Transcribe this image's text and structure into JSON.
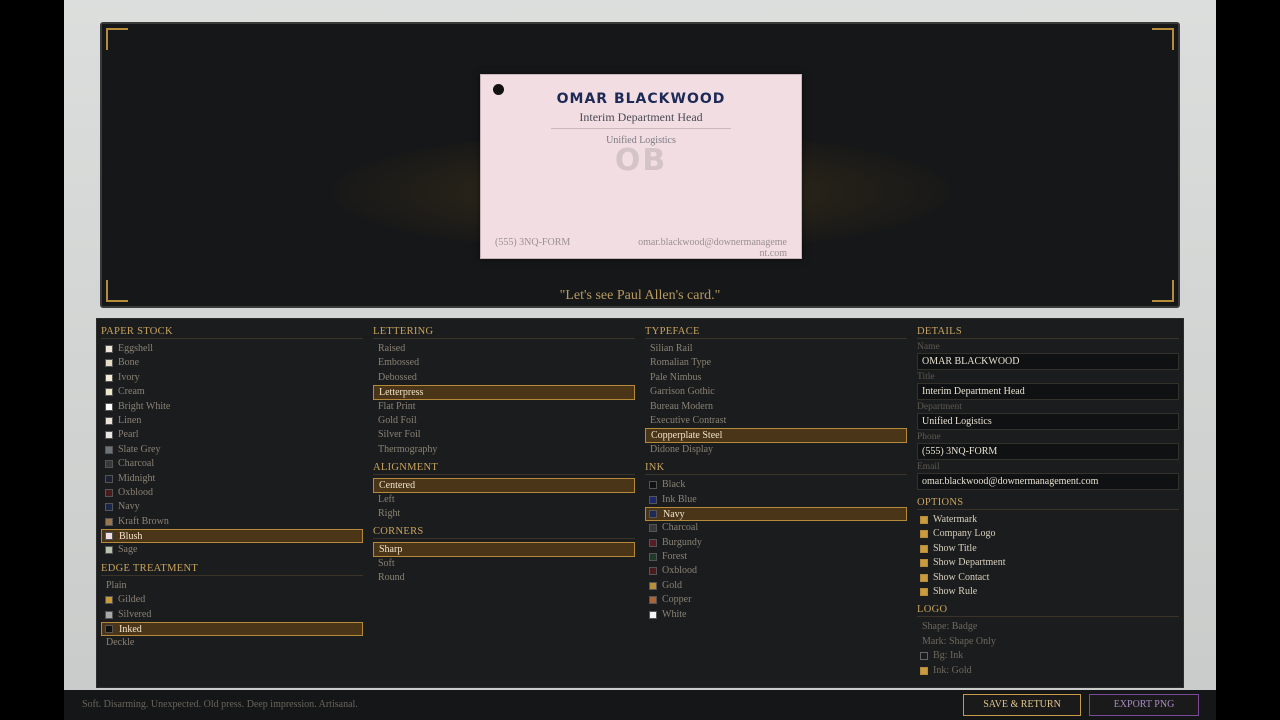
{
  "card": {
    "name": "OMAR BLACKWOOD",
    "title": "Interim Department Head",
    "department": "Unified Logistics",
    "monogram": "OB",
    "phone": "(555) 3NQ-FORM",
    "email": "omar.blackwood@downermanagement.com",
    "paper_color": "#f2dde2",
    "ink_color": "#1c2a55"
  },
  "preview": {
    "quote": "\"Let's see Paul Allen's card.\""
  },
  "paper_stock": {
    "heading": "PAPER STOCK",
    "items": [
      {
        "label": "Eggshell",
        "color": "#ece6d6",
        "selected": false
      },
      {
        "label": "Bone",
        "color": "#e5dcc6",
        "selected": false
      },
      {
        "label": "Ivory",
        "color": "#f2ecd9",
        "selected": false
      },
      {
        "label": "Cream",
        "color": "#efe5c9",
        "selected": false
      },
      {
        "label": "Bright White",
        "color": "#ffffff",
        "selected": false
      },
      {
        "label": "Linen",
        "color": "#ebe4d6",
        "selected": false
      },
      {
        "label": "Pearl",
        "color": "#e9e7e2",
        "selected": false
      },
      {
        "label": "Slate Grey",
        "color": "#6e7378",
        "selected": false
      },
      {
        "label": "Charcoal",
        "color": "#38393b",
        "selected": false
      },
      {
        "label": "Midnight",
        "color": "#1c2030",
        "selected": false
      },
      {
        "label": "Oxblood",
        "color": "#4a1a1c",
        "selected": false
      },
      {
        "label": "Navy",
        "color": "#1c2648",
        "selected": false
      },
      {
        "label": "Kraft Brown",
        "color": "#9a7650",
        "selected": false
      },
      {
        "label": "Blush",
        "color": "#f2dde2",
        "selected": true
      },
      {
        "label": "Sage",
        "color": "#b8c2ae",
        "selected": false
      }
    ]
  },
  "edge_treatment": {
    "heading": "EDGE TREATMENT",
    "items": [
      {
        "label": "Plain",
        "color": "",
        "selected": false
      },
      {
        "label": "Gilded",
        "color": "#c89b3e",
        "selected": false
      },
      {
        "label": "Silvered",
        "color": "#a9a9a9",
        "selected": false
      },
      {
        "label": "Inked",
        "color": "#111111",
        "selected": true
      },
      {
        "label": "Deckle",
        "color": "",
        "selected": false
      }
    ]
  },
  "lettering": {
    "heading": "LETTERING",
    "items": [
      {
        "label": "Raised",
        "selected": false
      },
      {
        "label": "Embossed",
        "selected": false
      },
      {
        "label": "Debossed",
        "selected": false
      },
      {
        "label": "Letterpress",
        "selected": true
      },
      {
        "label": "Flat Print",
        "selected": false
      },
      {
        "label": "Gold Foil",
        "selected": false
      },
      {
        "label": "Silver Foil",
        "selected": false
      },
      {
        "label": "Thermography",
        "selected": false
      }
    ]
  },
  "alignment": {
    "heading": "ALIGNMENT",
    "items": [
      {
        "label": "Centered",
        "selected": true
      },
      {
        "label": "Left",
        "selected": false
      },
      {
        "label": "Right",
        "selected": false
      }
    ]
  },
  "corners": {
    "heading": "CORNERS",
    "items": [
      {
        "label": "Sharp",
        "selected": true
      },
      {
        "label": "Soft",
        "selected": false
      },
      {
        "label": "Round",
        "selected": false
      }
    ]
  },
  "typeface": {
    "heading": "TYPEFACE",
    "items": [
      {
        "label": "Silian Rail",
        "selected": false
      },
      {
        "label": "Romalian Type",
        "selected": false
      },
      {
        "label": "Pale Nimbus",
        "selected": false
      },
      {
        "label": "Garrison Gothic",
        "selected": false
      },
      {
        "label": "Bureau Modern",
        "selected": false
      },
      {
        "label": "Executive Contrast",
        "selected": false
      },
      {
        "label": "Copperplate Steel",
        "selected": true
      },
      {
        "label": "Didone Display",
        "selected": false
      }
    ]
  },
  "ink": {
    "heading": "INK",
    "items": [
      {
        "label": "Black",
        "color": "#111111",
        "selected": false
      },
      {
        "label": "Ink Blue",
        "color": "#1c2a6a",
        "selected": false
      },
      {
        "label": "Navy",
        "color": "#1c2a55",
        "selected": true
      },
      {
        "label": "Charcoal",
        "color": "#36383a",
        "selected": false
      },
      {
        "label": "Burgundy",
        "color": "#5a1c24",
        "selected": false
      },
      {
        "label": "Forest",
        "color": "#1f3a26",
        "selected": false
      },
      {
        "label": "Oxblood",
        "color": "#4a1a1c",
        "selected": false
      },
      {
        "label": "Gold",
        "color": "#b8903c",
        "selected": false
      },
      {
        "label": "Copper",
        "color": "#a8643a",
        "selected": false
      },
      {
        "label": "White",
        "color": "#f4f4f4",
        "selected": false
      }
    ]
  },
  "details": {
    "heading": "DETAILS",
    "name_label": "Name",
    "name_value": "OMAR BLACKWOOD",
    "title_label": "Title",
    "title_value": "Interim Department Head",
    "department_label": "Department",
    "department_value": "Unified Logistics",
    "phone_label": "Phone",
    "phone_value": "(555) 3NQ-FORM",
    "email_label": "Email",
    "email_value": "omar.blackwood@downermanagement.com"
  },
  "options": {
    "heading": "OPTIONS",
    "items": [
      {
        "label": "Watermark",
        "checked": true
      },
      {
        "label": "Company Logo",
        "checked": true
      },
      {
        "label": "Show Title",
        "checked": true
      },
      {
        "label": "Show Department",
        "checked": true
      },
      {
        "label": "Show Contact",
        "checked": true
      },
      {
        "label": "Show Rule",
        "checked": true
      }
    ]
  },
  "logo": {
    "heading": "LOGO",
    "shape": "Shape: Badge",
    "mark": "Mark: Shape Only",
    "bg": "Bg: Ink",
    "bg_checked": false,
    "ink": "Ink: Gold",
    "ink_checked": true
  },
  "footer": {
    "status": "Soft. Disarming. Unexpected.   Old press. Deep impression. Artisanal.",
    "save_label": "SAVE & RETURN",
    "export_label": "EXPORT PNG"
  },
  "colors": {
    "accent": "#c89b3e",
    "selected_bg": "#4a3518",
    "export_accent": "#7c4a9a"
  }
}
